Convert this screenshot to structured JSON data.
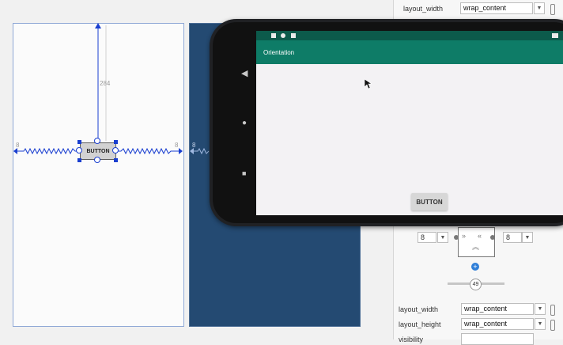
{
  "design": {
    "button_label": "BUTTON",
    "top_margin": "284",
    "left_margin": "8",
    "right_margin": "8",
    "blueprint_left_margin": "8"
  },
  "device": {
    "app_title": "Orientation",
    "button_label": "BUTTON"
  },
  "attributes": {
    "top_rows": [
      {
        "name": "layout_width",
        "value": "wrap_content"
      }
    ],
    "constraint_widget": {
      "left_margin": "8",
      "right_margin": "8",
      "bias": "49"
    },
    "rows": [
      {
        "name": "layout_width",
        "value": "wrap_content"
      },
      {
        "name": "layout_height",
        "value": "wrap_content"
      },
      {
        "name": "visibility",
        "value": ""
      }
    ]
  },
  "colors": {
    "accent": "#1a3fd0",
    "app_bar": "#0e7c67",
    "status_bar": "#0c5a4b",
    "blueprint": "#244a72"
  }
}
